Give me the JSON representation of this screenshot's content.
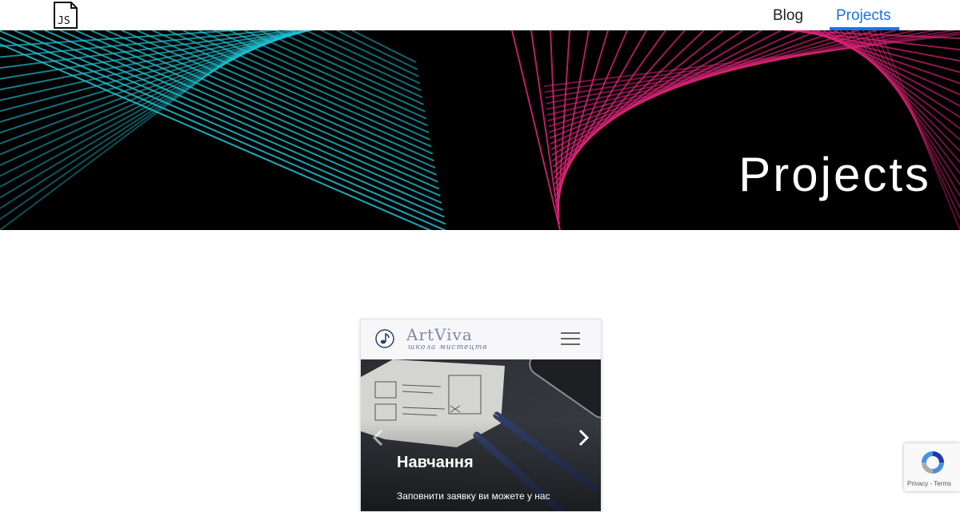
{
  "nav": {
    "blog": "Blog",
    "projects": "Projects",
    "active_color": "#1a73e8"
  },
  "logo": {
    "icon": "js-file-icon",
    "label": "JS"
  },
  "hero": {
    "title": "Projects",
    "left_line_color": "#1fc8d8",
    "right_line_color": "#e0257a"
  },
  "project_card": {
    "brand_name": "ArtViva",
    "brand_sub": "школа мистецтв",
    "brand_icon": "music-note-icon",
    "menu_icon": "hamburger-menu-icon",
    "slide": {
      "title": "Навчання",
      "text": "Заповнити заявку ви можете у нас",
      "prev_icon": "chevron-left-icon",
      "next_icon": "chevron-right-icon"
    }
  },
  "recaptcha": {
    "privacy": "Privacy",
    "separator": " - ",
    "terms": "Terms"
  }
}
